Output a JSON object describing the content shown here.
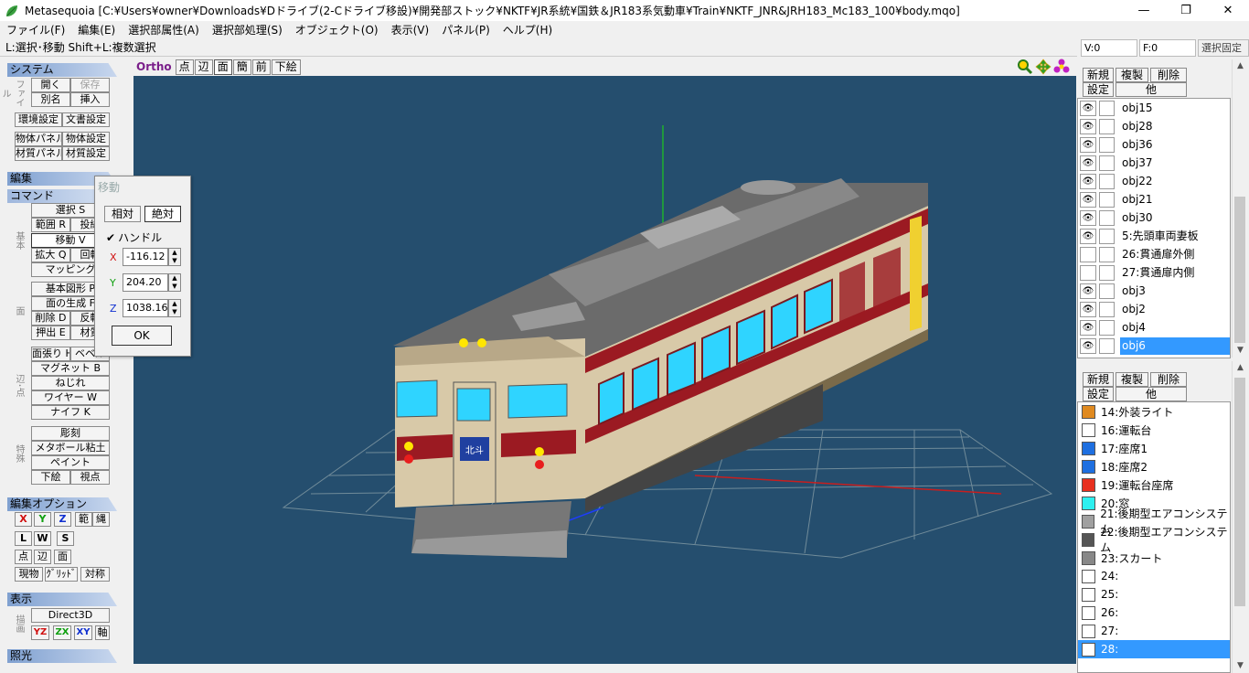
{
  "window": {
    "title": "Metasequoia [C:¥Users¥owner¥Downloads¥Dドライブ(2-Cドライブ移設)¥開発部ストック¥NKTF¥JR系統¥国鉄＆JR183系気動車¥Train¥NKTF_JNR&JRH183_Mc183_100¥body.mqo]",
    "minimize": "—",
    "maximize": "❐",
    "close": "✕"
  },
  "menu": [
    "ファイル(F)",
    "編集(E)",
    "選択部属性(A)",
    "選択部処理(S)",
    "オブジェクト(O)",
    "表示(V)",
    "パネル(P)",
    "ヘルプ(H)"
  ],
  "hint": "L:選択･移動  Shift+L:複数選択",
  "status": {
    "v": "V:0",
    "f": "F:0",
    "lock": "選択固定"
  },
  "left": {
    "system": "システム",
    "file_label": "ファイル",
    "open": "開く",
    "save": "保存",
    "save_as": "別名",
    "insert": "挿入",
    "env_settings": "環境設定",
    "doc_settings": "文書設定",
    "obj_panel": "物体パネル",
    "obj_settings": "物体設定",
    "mat_panel": "材質パネル",
    "mat_settings": "材質設定",
    "edit": "編集",
    "command": "コマンド",
    "select": "選択 S",
    "range": "範囲 R",
    "lasso": "投縄",
    "move": "移動 V",
    "scale": "拡大 Q",
    "rotate": "回転",
    "mapping": "マッピング",
    "basic_label": "基本",
    "basic_shape": "基本図形 P",
    "face_gen": "面の生成 F",
    "delete": "削除 D",
    "reverse": "反転",
    "extrude": "押出 E",
    "material": "材質",
    "face_label": "面",
    "knife_face": "面張り H",
    "bevel": "ベベル",
    "magnet": "マグネット B",
    "twist": "ねじれ",
    "wire": "ワイヤー W",
    "knife": "ナイフ K",
    "edge_label": "辺･点",
    "sculpt": "彫刻",
    "metaball": "メタボール粘土",
    "paint": "ペイント",
    "underlay": "下絵",
    "viewpoint": "視点",
    "special_label": "特殊",
    "edit_options": "編集オプション",
    "axis_x": "X",
    "axis_y": "Y",
    "axis_z": "Z",
    "opt_range": "範",
    "opt_lasso": "縄",
    "opt_l": "L",
    "opt_w": "W",
    "opt_s": "S",
    "opt_point": "点",
    "opt_edge": "辺",
    "opt_face": "面",
    "current": "現物",
    "grid": "ｸﾞﾘｯﾄﾞ",
    "symmetry": "対称",
    "display": "表示",
    "render_label": "描画",
    "direct3d": "Direct3D",
    "yz": "YZ",
    "zx": "ZX",
    "xy": "XY",
    "axis_btn": "軸",
    "lighting": "照光"
  },
  "viewport": {
    "ortho": "Ortho",
    "buttons": [
      "点",
      "辺",
      "面",
      "簡",
      "前",
      "下絵"
    ],
    "selected": "面"
  },
  "move_dialog": {
    "title": "移動",
    "relative": "相対",
    "absolute": "絶対",
    "handle_label": "ハンドル",
    "handle_checked": true,
    "x_label": "X",
    "x_value": "-116.12",
    "y_label": "Y",
    "y_value": "204.20",
    "z_label": "Z",
    "z_value": "1038.16",
    "ok": "OK"
  },
  "object_panel": {
    "new": "新規",
    "duplicate": "複製",
    "delete": "削除",
    "settings": "設定",
    "other": "他",
    "items": [
      {
        "name": "obj15",
        "visible": true
      },
      {
        "name": "obj28",
        "visible": true
      },
      {
        "name": "obj36",
        "visible": true
      },
      {
        "name": "obj37",
        "visible": true
      },
      {
        "name": "obj22",
        "visible": true
      },
      {
        "name": "obj21",
        "visible": true
      },
      {
        "name": "obj30",
        "visible": true
      },
      {
        "name": "5:先頭車両妻板",
        "visible": true
      },
      {
        "name": "26:貫通扉外側",
        "visible": false
      },
      {
        "name": "27:貫通扉内側",
        "visible": false
      },
      {
        "name": "obj3",
        "visible": true
      },
      {
        "name": "obj2",
        "visible": true
      },
      {
        "name": "obj4",
        "visible": true
      },
      {
        "name": "obj6",
        "visible": true,
        "selected": true
      }
    ]
  },
  "material_panel": {
    "new": "新規",
    "duplicate": "複製",
    "delete": "削除",
    "settings": "設定",
    "other": "他",
    "items": [
      {
        "name": "14:外装ライト",
        "color": "#e08a20"
      },
      {
        "name": "16:運転台",
        "color": "#ffffff"
      },
      {
        "name": "17:座席1",
        "color": "#1e6fe0"
      },
      {
        "name": "18:座席2",
        "color": "#1e6fe0"
      },
      {
        "name": "19:運転台座席",
        "color": "#e8301e"
      },
      {
        "name": "20:窓",
        "color": "#2ef0f0"
      },
      {
        "name": "21:後期型エアコンシステム",
        "color": "#a0a0a0"
      },
      {
        "name": "22:後期型エアコンシステム",
        "color": "#555555"
      },
      {
        "name": "23:スカート",
        "color": "#888888"
      },
      {
        "name": "24:",
        "color": "#ffffff"
      },
      {
        "name": "25:",
        "color": "#ffffff"
      },
      {
        "name": "26:",
        "color": "#ffffff"
      },
      {
        "name": "27:",
        "color": "#ffffff"
      },
      {
        "name": "28:",
        "color": "#ffffff",
        "selected": true
      }
    ]
  },
  "train": {
    "headmark": "北斗"
  }
}
